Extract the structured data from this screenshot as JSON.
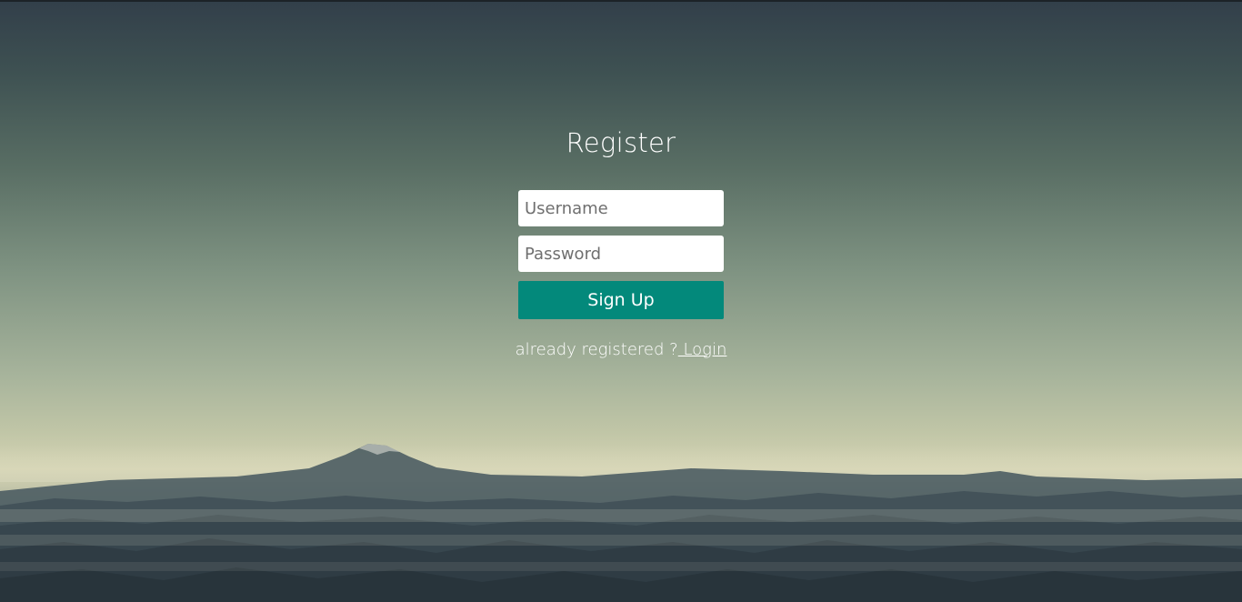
{
  "page": {
    "title": "Register"
  },
  "form": {
    "username_placeholder": "Username",
    "password_placeholder": "Password",
    "signup_label": "Sign Up",
    "already_text": "already registered ?",
    "login_link": " Login"
  },
  "colors": {
    "button": "#03897b",
    "text": "#ffffff",
    "input_bg": "#ffffff"
  }
}
